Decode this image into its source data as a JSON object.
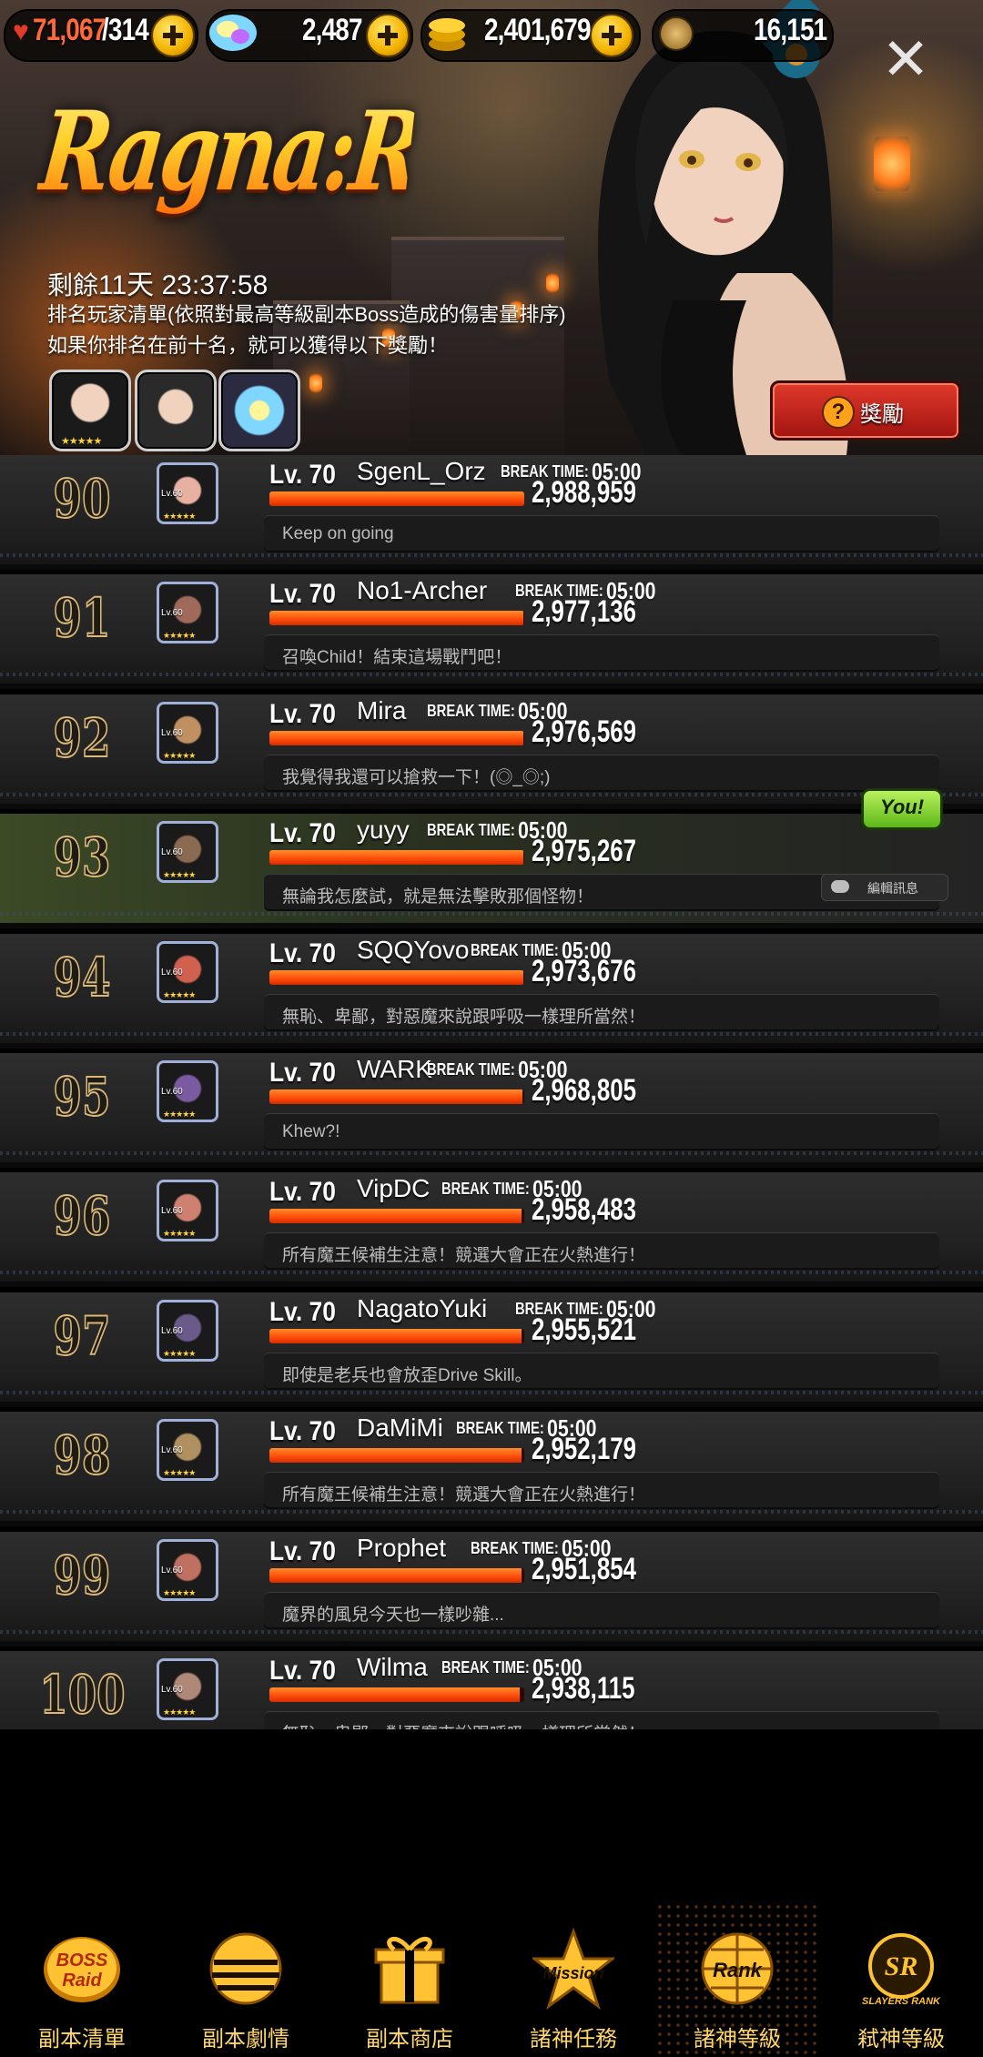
{
  "resources": [
    {
      "icon": "heart-icon",
      "value": "71,067",
      "sub": "/314"
    },
    {
      "icon": "crystal-icon",
      "value": "2,487"
    },
    {
      "icon": "gold-coin-icon",
      "value": "2,401,679"
    },
    {
      "icon": "medal-icon",
      "value": "16,151"
    }
  ],
  "event": {
    "title": "Ragna:Rank",
    "countdown_prefix": "剩餘",
    "countdown": "11天 23:37:58",
    "desc_line1": "排名玩家清單(依照對最高等級副本Boss造成的傷害量排序)",
    "desc_line2": "如果你排名在前十名，就可以獲得以下獎勵！",
    "reward_button": "獎勵"
  },
  "colors": {
    "accent": "#ffd23a",
    "damage_bar": "#ff4a0a",
    "you_badge": "#7ed321"
  },
  "ranking": [
    {
      "rank": "90",
      "level_label": "Lv. 70",
      "name": "SgenL_Orz",
      "break_label": "BREAK TIME:",
      "break_time": "05:00",
      "damage": "2,988,959",
      "damage_ratio": 1.0,
      "comment": "Keep on going"
    },
    {
      "rank": "91",
      "level_label": "Lv. 70",
      "name": "No1-Archer",
      "break_label": "BREAK TIME:",
      "break_time": "05:00",
      "damage": "2,977,136",
      "damage_ratio": 0.996,
      "comment": "召喚Child！結束這場戰鬥吧！"
    },
    {
      "rank": "92",
      "level_label": "Lv. 70",
      "name": "Mira",
      "break_label": "BREAK TIME:",
      "break_time": "05:00",
      "damage": "2,976,569",
      "damage_ratio": 0.996,
      "comment": "我覺得我還可以搶救一下！(◎_◎;)"
    },
    {
      "rank": "93",
      "level_label": "Lv. 70",
      "name": "yuyy",
      "break_label": "BREAK TIME:",
      "break_time": "05:00",
      "damage": "2,975,267",
      "damage_ratio": 0.995,
      "comment": "無論我怎麼試，就是無法擊敗那個怪物！",
      "is_me": true
    },
    {
      "rank": "94",
      "level_label": "Lv. 70",
      "name": "SQQYovo",
      "break_label": "BREAK TIME:",
      "break_time": "05:00",
      "damage": "2,973,676",
      "damage_ratio": 0.995,
      "comment": "無恥、卑鄙，對惡魔來說跟呼吸一樣理所當然！"
    },
    {
      "rank": "95",
      "level_label": "Lv. 70",
      "name": "WARK",
      "break_label": "BREAK TIME:",
      "break_time": "05:00",
      "damage": "2,968,805",
      "damage_ratio": 0.993,
      "comment": "Khew?!"
    },
    {
      "rank": "96",
      "level_label": "Lv. 70",
      "name": "VipDC",
      "break_label": "BREAK TIME:",
      "break_time": "05:00",
      "damage": "2,958,483",
      "damage_ratio": 0.99,
      "comment": "所有魔王候補生注意！競選大會正在火熱進行！"
    },
    {
      "rank": "97",
      "level_label": "Lv. 70",
      "name": "NagatoYuki",
      "break_label": "BREAK TIME:",
      "break_time": "05:00",
      "damage": "2,955,521",
      "damage_ratio": 0.989,
      "comment": "即使是老兵也會放歪Drive Skill。"
    },
    {
      "rank": "98",
      "level_label": "Lv. 70",
      "name": "DaMiMi",
      "break_label": "BREAK TIME:",
      "break_time": "05:00",
      "damage": "2,952,179",
      "damage_ratio": 0.988,
      "comment": "所有魔王候補生注意！競選大會正在火熱進行！"
    },
    {
      "rank": "99",
      "level_label": "Lv. 70",
      "name": "Prophet",
      "break_label": "BREAK TIME:",
      "break_time": "05:00",
      "damage": "2,951,854",
      "damage_ratio": 0.988,
      "comment": "魔界的風兒今天也一樣吵雜..."
    },
    {
      "rank": "100",
      "level_label": "Lv. 70",
      "name": "Wilma",
      "break_label": "BREAK TIME:",
      "break_time": "05:00",
      "damage": "2,938,115",
      "damage_ratio": 0.983,
      "comment": "無恥、卑鄙，對惡魔來說跟呼吸一樣理所當然！"
    }
  ],
  "avatar_badge": {
    "level": "Lv.60",
    "stars": "★★★★★"
  },
  "you_badge": "You!",
  "edit_message": "編輯訊息",
  "bottom_nav": [
    {
      "label": "副本清單",
      "icon": "boss-raid-icon",
      "icon_text": "BOSS Raid"
    },
    {
      "label": "副本劇情",
      "icon": "story-orb-icon"
    },
    {
      "label": "副本商店",
      "icon": "gift-box-icon"
    },
    {
      "label": "諸神任務",
      "icon": "mission-star-icon",
      "icon_text": "Mission"
    },
    {
      "label": "諸神等級",
      "icon": "rank-globe-icon",
      "icon_text": "Rank",
      "active": true
    },
    {
      "label": "弒神等級",
      "icon": "slayers-rank-icon",
      "icon_text": "SLAYERS RANK"
    }
  ]
}
